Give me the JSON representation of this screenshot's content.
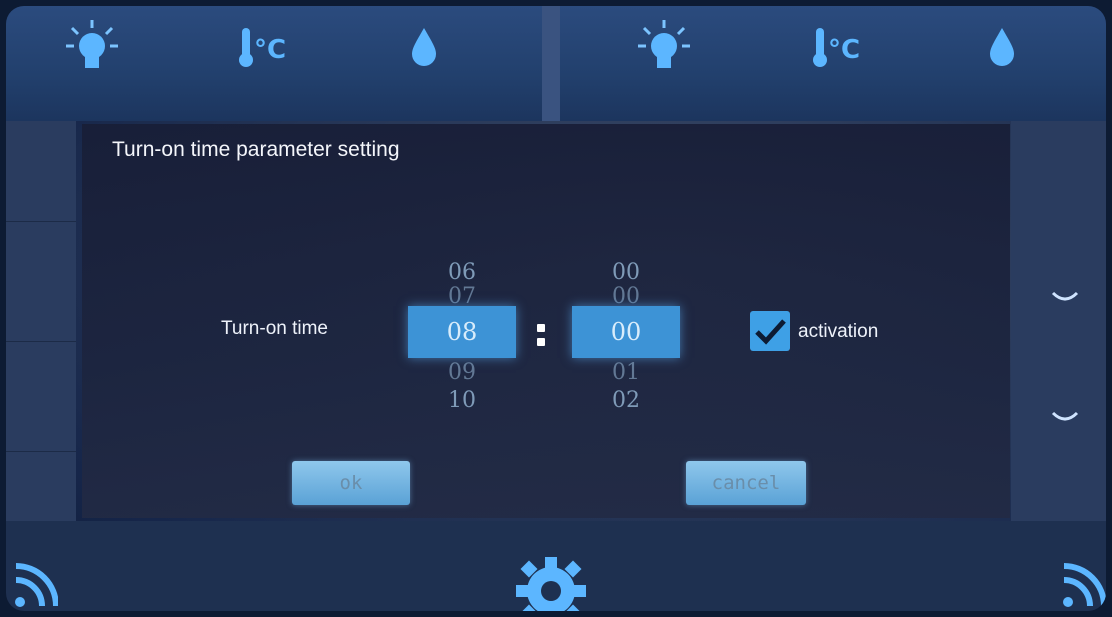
{
  "top_bar": {
    "icons": [
      "light-bulb-icon",
      "thermometer-celsius-icon",
      "water-drop-icon",
      "light-bulb-icon",
      "thermometer-celsius-icon",
      "water-drop-icon"
    ],
    "celsius_label": "°C"
  },
  "dialog": {
    "title": "Turn-on time parameter setting",
    "time_label": "Turn-on time",
    "hour_picker": {
      "above": [
        "06",
        "07"
      ],
      "selected": "08",
      "below": [
        "09",
        "10"
      ]
    },
    "minute_picker": {
      "above": [
        "00",
        "00"
      ],
      "selected": "00",
      "below": [
        "01",
        "02"
      ]
    },
    "separator": ":",
    "activation": {
      "label": "activation",
      "checked": true
    },
    "ok_label": "ok",
    "cancel_label": "cancel"
  },
  "bottom_bar": {
    "icons": [
      "wifi-icon",
      "settings-gear-icon",
      "wifi-icon"
    ]
  },
  "colors": {
    "accent": "#3d93d6",
    "checkbox": "#3ea0e6",
    "icon_glow": "#5cb6ff"
  }
}
